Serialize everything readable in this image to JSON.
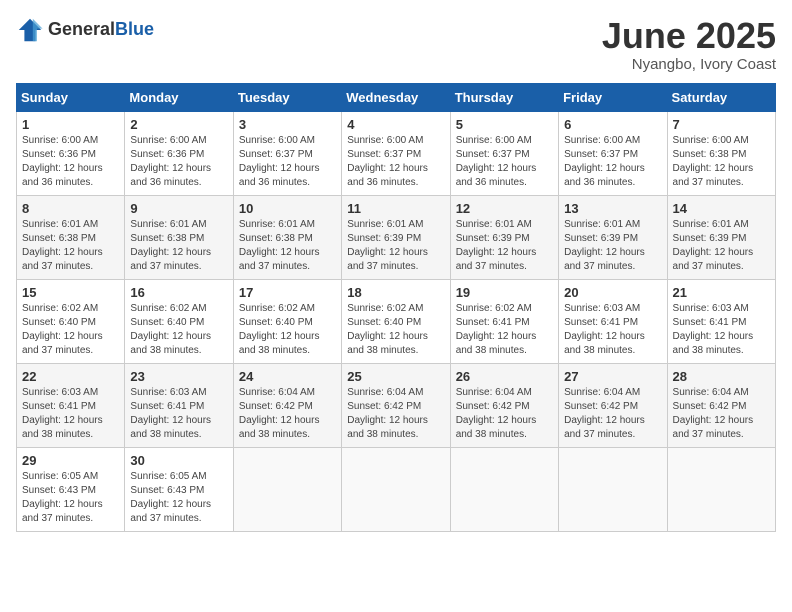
{
  "logo": {
    "general": "General",
    "blue": "Blue"
  },
  "title": "June 2025",
  "subtitle": "Nyangbo, Ivory Coast",
  "weekdays": [
    "Sunday",
    "Monday",
    "Tuesday",
    "Wednesday",
    "Thursday",
    "Friday",
    "Saturday"
  ],
  "weeks": [
    [
      {
        "day": "1",
        "info": "Sunrise: 6:00 AM\nSunset: 6:36 PM\nDaylight: 12 hours\nand 36 minutes."
      },
      {
        "day": "2",
        "info": "Sunrise: 6:00 AM\nSunset: 6:36 PM\nDaylight: 12 hours\nand 36 minutes."
      },
      {
        "day": "3",
        "info": "Sunrise: 6:00 AM\nSunset: 6:37 PM\nDaylight: 12 hours\nand 36 minutes."
      },
      {
        "day": "4",
        "info": "Sunrise: 6:00 AM\nSunset: 6:37 PM\nDaylight: 12 hours\nand 36 minutes."
      },
      {
        "day": "5",
        "info": "Sunrise: 6:00 AM\nSunset: 6:37 PM\nDaylight: 12 hours\nand 36 minutes."
      },
      {
        "day": "6",
        "info": "Sunrise: 6:00 AM\nSunset: 6:37 PM\nDaylight: 12 hours\nand 36 minutes."
      },
      {
        "day": "7",
        "info": "Sunrise: 6:00 AM\nSunset: 6:38 PM\nDaylight: 12 hours\nand 37 minutes."
      }
    ],
    [
      {
        "day": "8",
        "info": "Sunrise: 6:01 AM\nSunset: 6:38 PM\nDaylight: 12 hours\nand 37 minutes."
      },
      {
        "day": "9",
        "info": "Sunrise: 6:01 AM\nSunset: 6:38 PM\nDaylight: 12 hours\nand 37 minutes."
      },
      {
        "day": "10",
        "info": "Sunrise: 6:01 AM\nSunset: 6:38 PM\nDaylight: 12 hours\nand 37 minutes."
      },
      {
        "day": "11",
        "info": "Sunrise: 6:01 AM\nSunset: 6:39 PM\nDaylight: 12 hours\nand 37 minutes."
      },
      {
        "day": "12",
        "info": "Sunrise: 6:01 AM\nSunset: 6:39 PM\nDaylight: 12 hours\nand 37 minutes."
      },
      {
        "day": "13",
        "info": "Sunrise: 6:01 AM\nSunset: 6:39 PM\nDaylight: 12 hours\nand 37 minutes."
      },
      {
        "day": "14",
        "info": "Sunrise: 6:01 AM\nSunset: 6:39 PM\nDaylight: 12 hours\nand 37 minutes."
      }
    ],
    [
      {
        "day": "15",
        "info": "Sunrise: 6:02 AM\nSunset: 6:40 PM\nDaylight: 12 hours\nand 37 minutes."
      },
      {
        "day": "16",
        "info": "Sunrise: 6:02 AM\nSunset: 6:40 PM\nDaylight: 12 hours\nand 38 minutes."
      },
      {
        "day": "17",
        "info": "Sunrise: 6:02 AM\nSunset: 6:40 PM\nDaylight: 12 hours\nand 38 minutes."
      },
      {
        "day": "18",
        "info": "Sunrise: 6:02 AM\nSunset: 6:40 PM\nDaylight: 12 hours\nand 38 minutes."
      },
      {
        "day": "19",
        "info": "Sunrise: 6:02 AM\nSunset: 6:41 PM\nDaylight: 12 hours\nand 38 minutes."
      },
      {
        "day": "20",
        "info": "Sunrise: 6:03 AM\nSunset: 6:41 PM\nDaylight: 12 hours\nand 38 minutes."
      },
      {
        "day": "21",
        "info": "Sunrise: 6:03 AM\nSunset: 6:41 PM\nDaylight: 12 hours\nand 38 minutes."
      }
    ],
    [
      {
        "day": "22",
        "info": "Sunrise: 6:03 AM\nSunset: 6:41 PM\nDaylight: 12 hours\nand 38 minutes."
      },
      {
        "day": "23",
        "info": "Sunrise: 6:03 AM\nSunset: 6:41 PM\nDaylight: 12 hours\nand 38 minutes."
      },
      {
        "day": "24",
        "info": "Sunrise: 6:04 AM\nSunset: 6:42 PM\nDaylight: 12 hours\nand 38 minutes."
      },
      {
        "day": "25",
        "info": "Sunrise: 6:04 AM\nSunset: 6:42 PM\nDaylight: 12 hours\nand 38 minutes."
      },
      {
        "day": "26",
        "info": "Sunrise: 6:04 AM\nSunset: 6:42 PM\nDaylight: 12 hours\nand 38 minutes."
      },
      {
        "day": "27",
        "info": "Sunrise: 6:04 AM\nSunset: 6:42 PM\nDaylight: 12 hours\nand 37 minutes."
      },
      {
        "day": "28",
        "info": "Sunrise: 6:04 AM\nSunset: 6:42 PM\nDaylight: 12 hours\nand 37 minutes."
      }
    ],
    [
      {
        "day": "29",
        "info": "Sunrise: 6:05 AM\nSunset: 6:43 PM\nDaylight: 12 hours\nand 37 minutes."
      },
      {
        "day": "30",
        "info": "Sunrise: 6:05 AM\nSunset: 6:43 PM\nDaylight: 12 hours\nand 37 minutes."
      },
      {
        "day": "",
        "info": ""
      },
      {
        "day": "",
        "info": ""
      },
      {
        "day": "",
        "info": ""
      },
      {
        "day": "",
        "info": ""
      },
      {
        "day": "",
        "info": ""
      }
    ]
  ]
}
